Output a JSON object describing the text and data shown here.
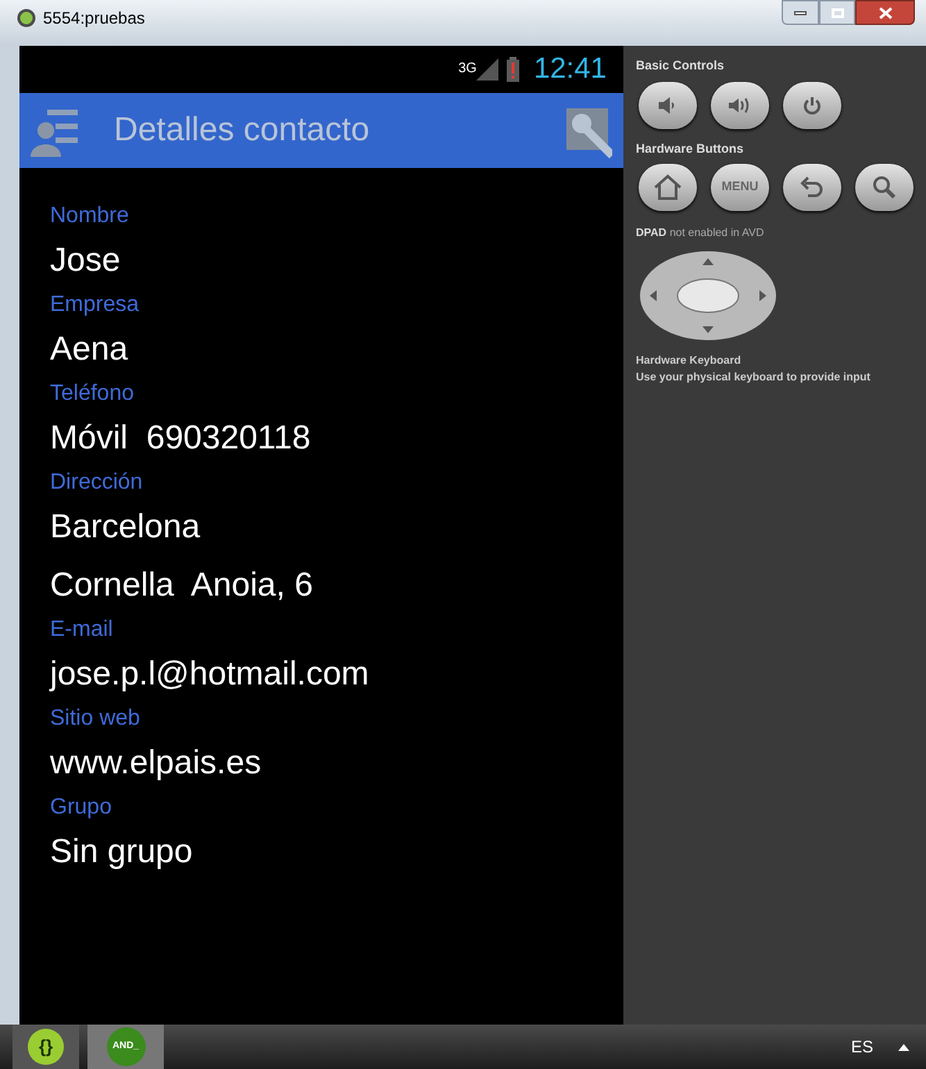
{
  "window": {
    "title": "5554:pruebas"
  },
  "status_bar": {
    "network": "3G",
    "time": "12:41"
  },
  "action_bar": {
    "title": "Detalles contacto"
  },
  "fields": [
    {
      "kind": "label",
      "text": "Nombre"
    },
    {
      "kind": "value",
      "text": "Jose"
    },
    {
      "kind": "label",
      "text": "Empresa"
    },
    {
      "kind": "value",
      "text": "Aena"
    },
    {
      "kind": "label",
      "text": "Teléfono"
    },
    {
      "kind": "value",
      "text": "Móvil  690320118"
    },
    {
      "kind": "label",
      "text": "Dirección"
    },
    {
      "kind": "value",
      "text": "Barcelona"
    },
    {
      "kind": "value",
      "text": "Cornella  Anoia, 6"
    },
    {
      "kind": "label",
      "text": "E-mail"
    },
    {
      "kind": "value",
      "text": "jose.p.l@hotmail.com"
    },
    {
      "kind": "label",
      "text": "Sitio web"
    },
    {
      "kind": "value",
      "text": "www.elpais.es"
    },
    {
      "kind": "label",
      "text": "Grupo"
    },
    {
      "kind": "value",
      "text": "Sin grupo"
    }
  ],
  "controls": {
    "basic_title": "Basic Controls",
    "hardware_title": "Hardware Buttons",
    "menu_label": "MENU",
    "dpad_title": "DPAD",
    "dpad_note": "not enabled in AVD",
    "keyboard_title": "Hardware Keyboard",
    "keyboard_note": "Use your physical keyboard to provide input"
  },
  "taskbar": {
    "app_icon_text": "{}",
    "emulator_icon_text": "AND_",
    "language": "ES"
  }
}
